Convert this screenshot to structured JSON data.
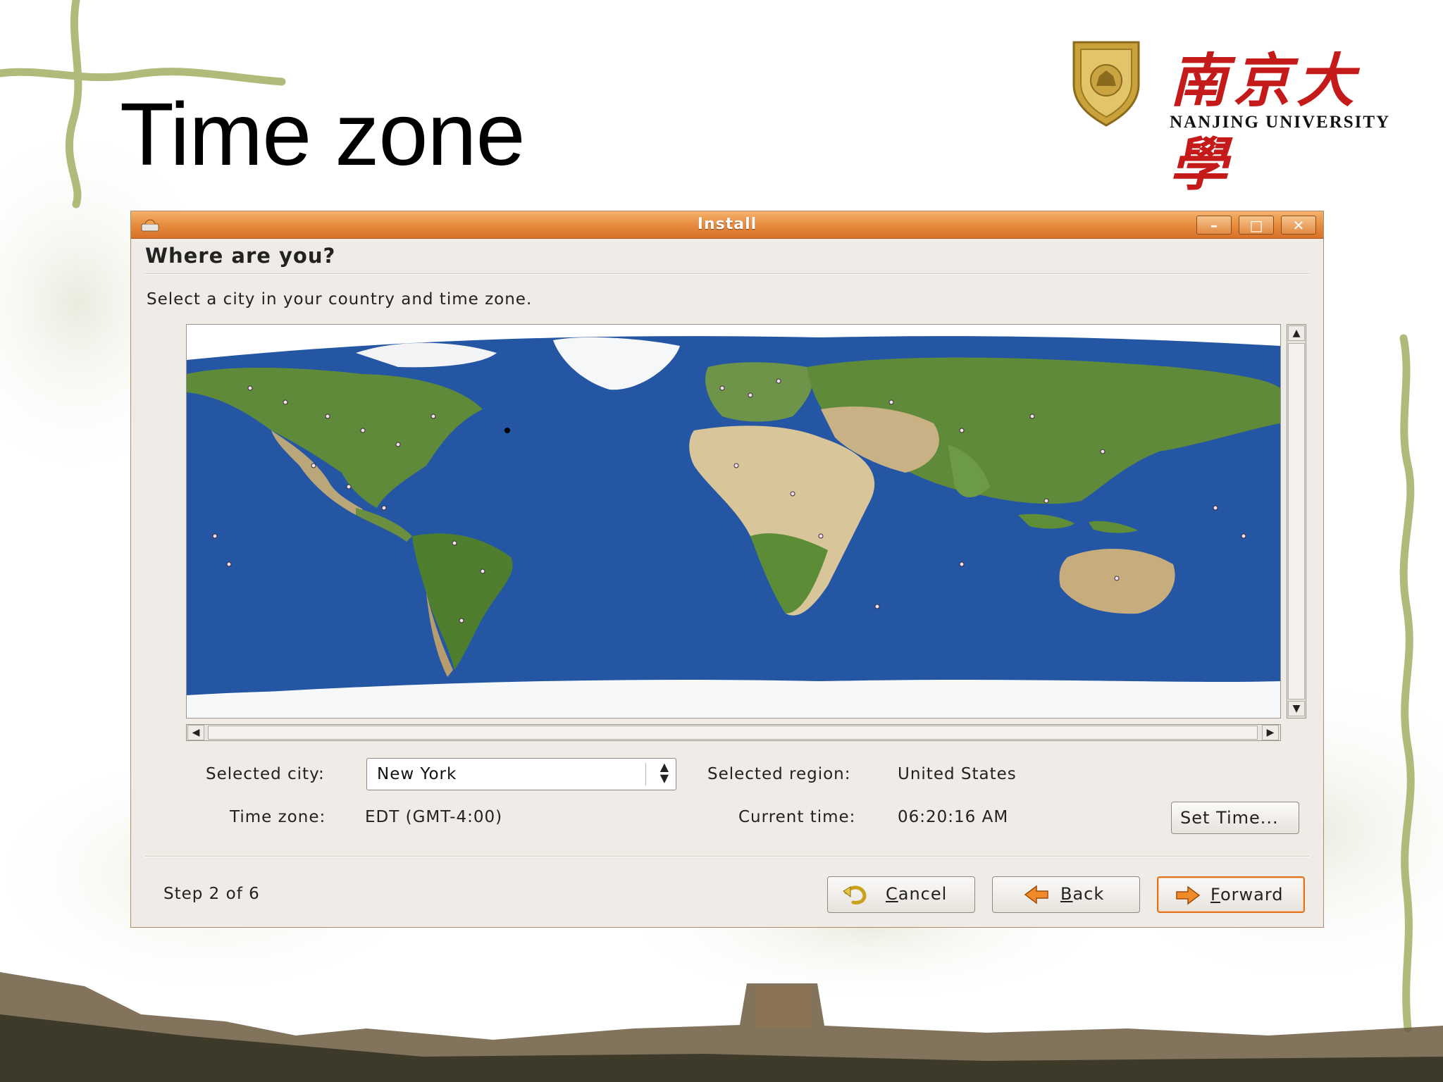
{
  "slide": {
    "title": "Time zone",
    "logo": {
      "chinese_name": "南京大學",
      "english_name": "NANJING UNIVERSITY",
      "shield_icon": "university-seal-icon"
    }
  },
  "window": {
    "title": "Install",
    "controls": {
      "minimize_icon": "minimize-icon",
      "maximize_icon": "maximize-icon",
      "close_icon": "close-icon"
    },
    "heading": "Where are you?",
    "instruction": "Select a city in your country and time zone.",
    "map": {
      "icon": "world-map-image"
    },
    "fields": {
      "selected_city_label": "Selected city:",
      "selected_city_value": "New York",
      "selected_region_label": "Selected region:",
      "selected_region_value": "United States",
      "time_zone_label": "Time zone:",
      "time_zone_value": "EDT (GMT-4:00)",
      "current_time_label": "Current time:",
      "current_time_value": "06:20:16 AM",
      "set_time_button": "Set Time..."
    },
    "footer": {
      "step": "Step 2 of 6",
      "cancel": {
        "mnemonic": "C",
        "rest": "ancel",
        "icon": "undo-arrow-icon"
      },
      "back": {
        "mnemonic": "B",
        "rest": "ack",
        "icon": "left-arrow-icon"
      },
      "forward": {
        "mnemonic": "F",
        "rest": "orward",
        "icon": "right-arrow-icon"
      }
    }
  },
  "colors": {
    "titlebar": "#e6893a",
    "ocean": "#2456a4",
    "accent": "#e0721f",
    "logo_red": "#c41a1a"
  }
}
